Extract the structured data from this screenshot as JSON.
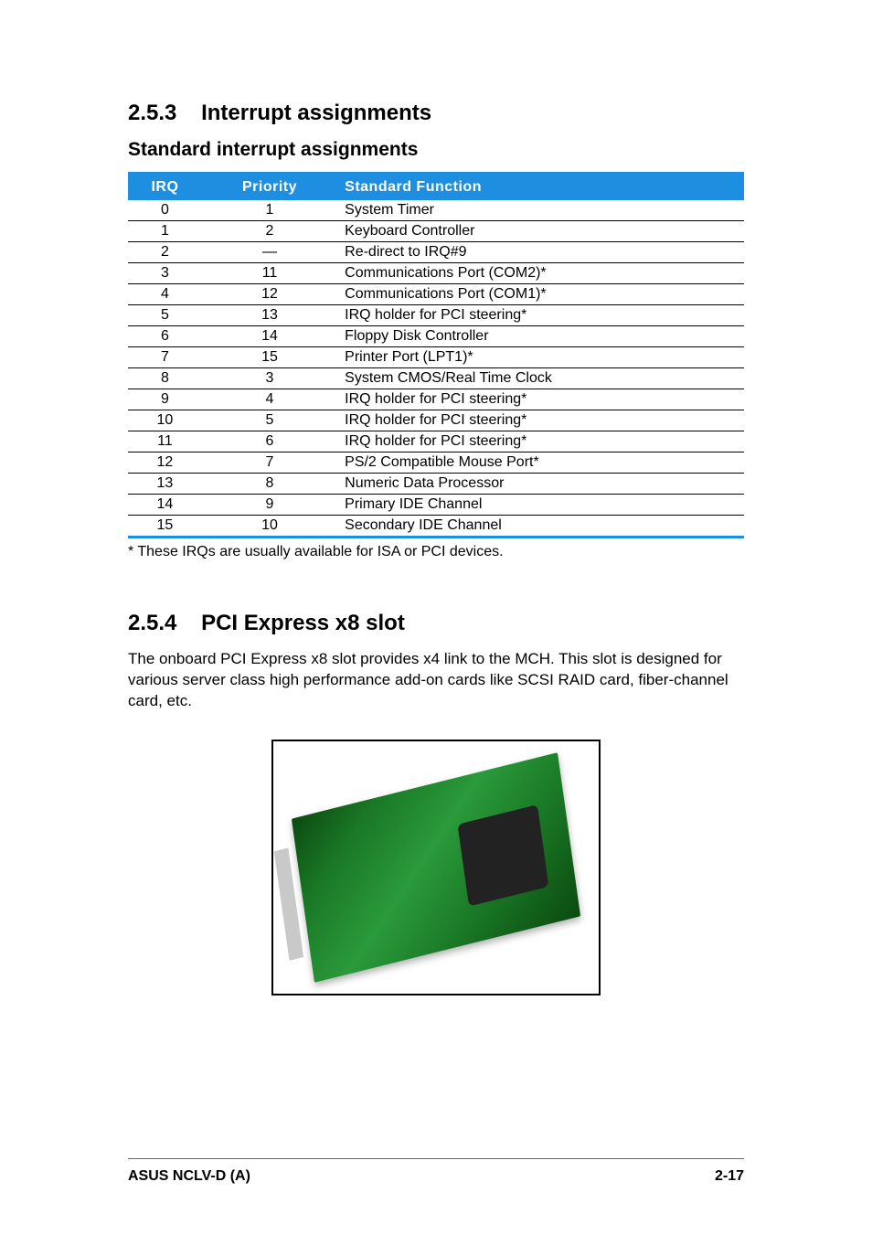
{
  "section1": {
    "number": "2.5.3",
    "title": "Interrupt assignments",
    "subtitle": "Standard interrupt assignments"
  },
  "table": {
    "headers": {
      "irq": "IRQ",
      "priority": "Priority",
      "func": "Standard Function"
    },
    "rows": [
      {
        "irq": "0",
        "priority": "1",
        "func": "System Timer"
      },
      {
        "irq": "1",
        "priority": "2",
        "func": "Keyboard Controller"
      },
      {
        "irq": "2",
        "priority": "—",
        "func": "Re-direct to IRQ#9"
      },
      {
        "irq": "3",
        "priority": "11",
        "func": "Communications Port (COM2)*"
      },
      {
        "irq": "4",
        "priority": "12",
        "func": "Communications Port (COM1)*"
      },
      {
        "irq": "5",
        "priority": "13",
        "func": "IRQ holder for PCI steering*"
      },
      {
        "irq": "6",
        "priority": "14",
        "func": "Floppy Disk Controller"
      },
      {
        "irq": "7",
        "priority": "15",
        "func": "Printer Port (LPT1)*"
      },
      {
        "irq": "8",
        "priority": "3",
        "func": "System CMOS/Real Time Clock"
      },
      {
        "irq": "9",
        "priority": "4",
        "func": "IRQ holder for PCI steering*"
      },
      {
        "irq": "10",
        "priority": "5",
        "func": "IRQ holder for PCI steering*"
      },
      {
        "irq": "11",
        "priority": "6",
        "func": "IRQ holder for PCI steering*"
      },
      {
        "irq": "12",
        "priority": "7",
        "func": "PS/2 Compatible Mouse Port*"
      },
      {
        "irq": "13",
        "priority": "8",
        "func": "Numeric Data Processor"
      },
      {
        "irq": "14",
        "priority": "9",
        "func": "Primary IDE Channel"
      },
      {
        "irq": "15",
        "priority": "10",
        "func": "Secondary IDE Channel"
      }
    ]
  },
  "footnote": "* These IRQs are usually available for ISA or PCI devices.",
  "section2": {
    "number": "2.5.4",
    "title": "PCI Express x8 slot",
    "body": "The onboard PCI Express x8 slot provides x4 link to the MCH. This slot is designed for various server class high performance add-on cards like SCSI RAID card, fiber-channel card, etc."
  },
  "footer": {
    "left": "ASUS NCLV-D (A)",
    "right": "2-17"
  }
}
